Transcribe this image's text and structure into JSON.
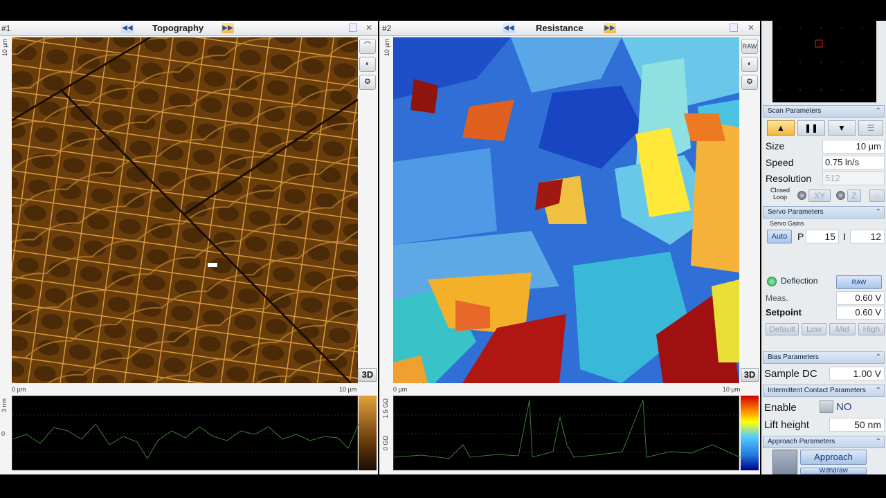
{
  "window1": {
    "number": "#1",
    "title": "Topography",
    "axis_top": "10 µm",
    "axis_x_start": "0 µm",
    "axis_x_end": "10 µm",
    "btn3d": "3D",
    "profile_top": "3 nm",
    "profile_mid": "0"
  },
  "window2": {
    "number": "#2",
    "title": "Resistance",
    "axis_top": "10 µm",
    "axis_x_start": "0 µm",
    "axis_x_end": "10 µm",
    "btn3d": "3D",
    "raw_label": "RAW",
    "profile_top": "1.5 GΩ",
    "profile_mid": "0 GΩ"
  },
  "scan": {
    "header": "Scan Parameters",
    "size_label": "Size",
    "size_value": "10 µm",
    "speed_label": "Speed",
    "speed_value": "0.75 ln/s",
    "resolution_label": "Resolution",
    "resolution_value": "512",
    "closed_loop_label": "Closed Loop",
    "xy_label": "XY",
    "z_label": "Z"
  },
  "servo": {
    "header": "Servo Parameters",
    "gains_label": "Servo Gains",
    "auto_label": "Auto",
    "p_label": "P",
    "p_value": "15",
    "i_label": "I",
    "i_value": "12",
    "deflection_label": "Deflection",
    "raw_label": "RAW",
    "meas_label": "Meas.",
    "meas_value": "0.60 V",
    "setpoint_label": "Setpoint",
    "setpoint_value": "0.60 V",
    "default_label": "Default",
    "low_label": "Low",
    "mid_label": "Mid",
    "high_label": "High"
  },
  "bias": {
    "header": "Bias Parameters",
    "sample_dc_label": "Sample DC",
    "sample_dc_value": "1.00 V"
  },
  "intermittent": {
    "header": "Intermittent Contact Parameters",
    "enable_label": "Enable",
    "enable_value": "NO",
    "lift_label": "Lift height",
    "lift_value": "50 nm"
  },
  "approach": {
    "header": "Approach Parameters",
    "approach_label": "Approach",
    "withdraw_label": "Withdraw"
  },
  "colors": {
    "topo_dark": "#3d2306",
    "topo_light": "#e2a23e",
    "res_blue": "#2f6fd6",
    "res_red": "#a81410",
    "accent": "#f3b63e"
  }
}
